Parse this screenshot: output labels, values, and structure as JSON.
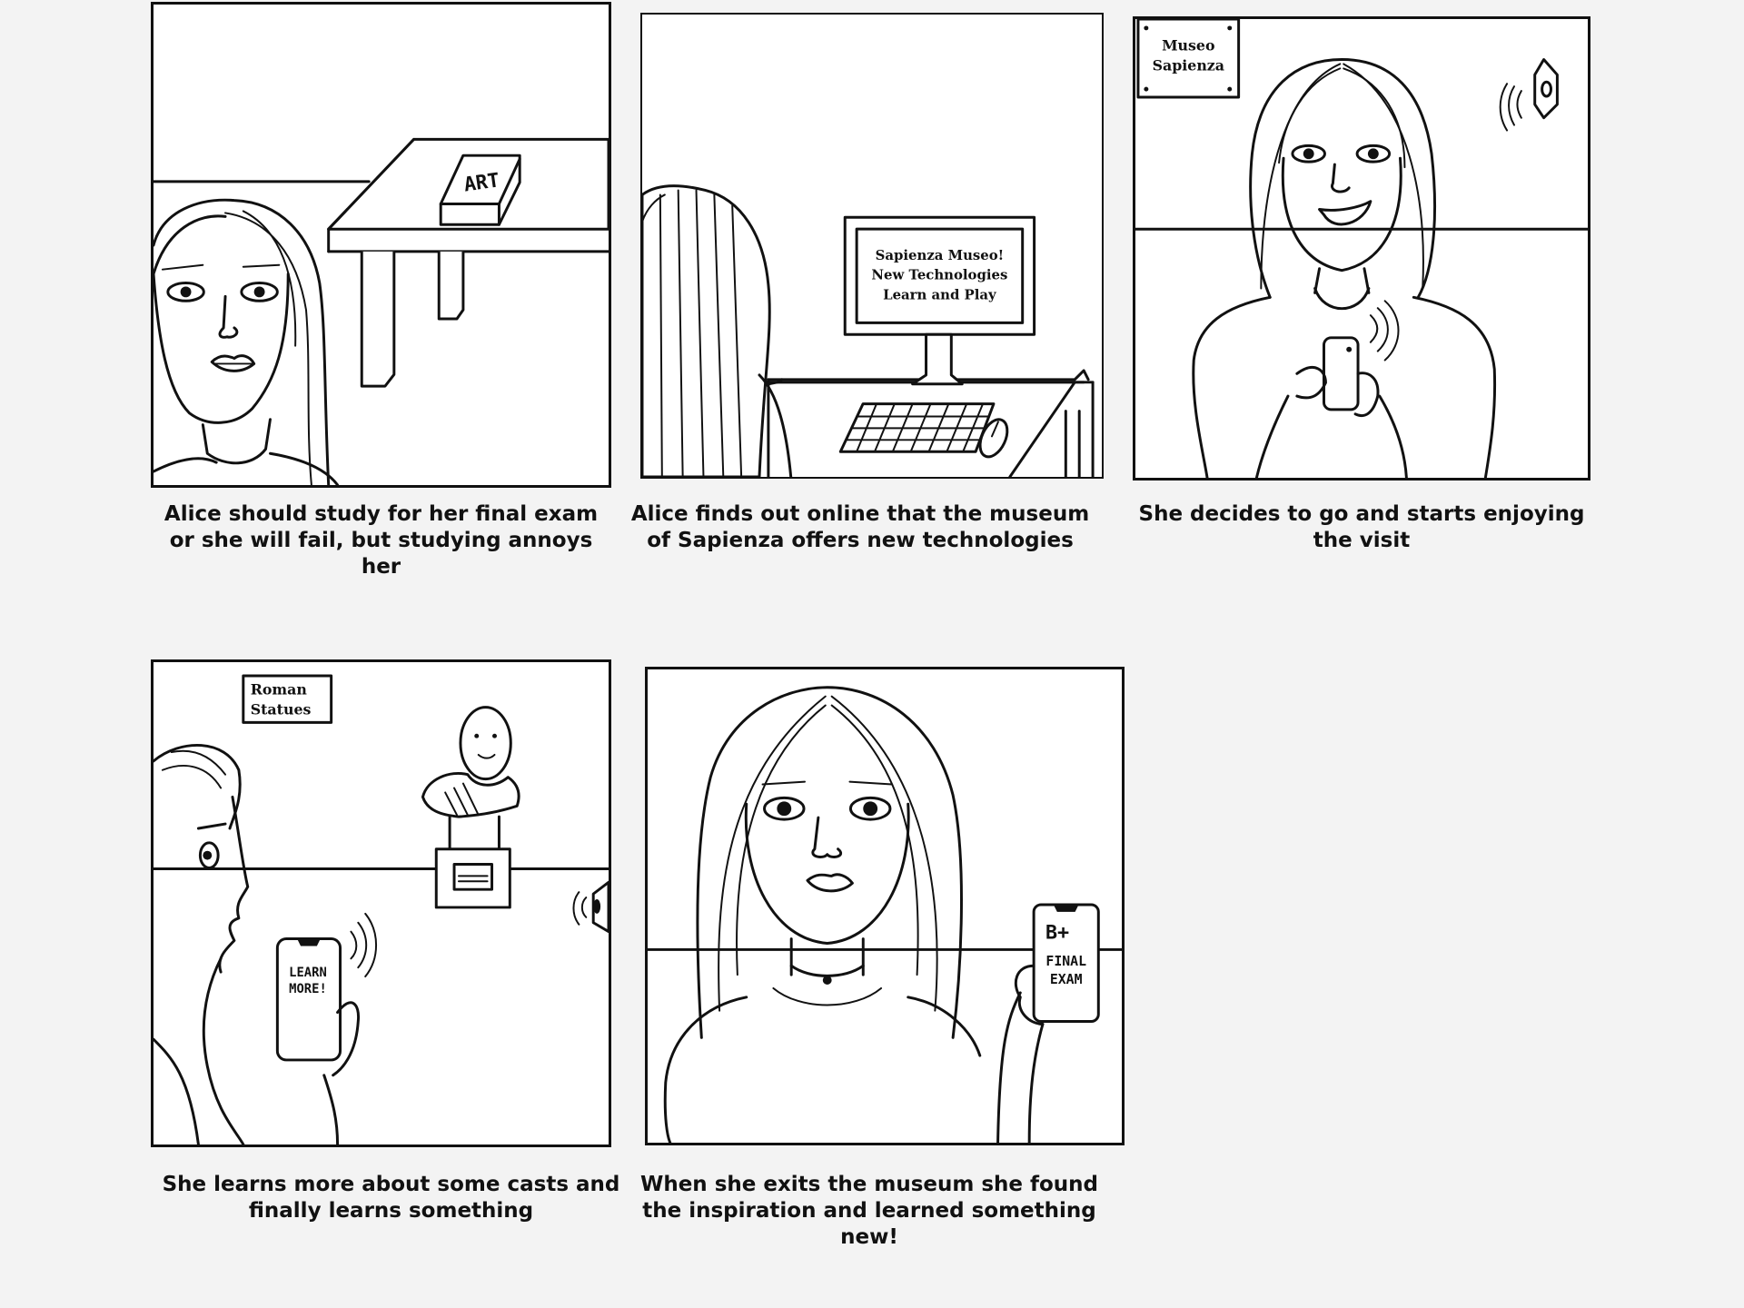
{
  "panels": [
    {
      "caption": "Alice should study for her final exam or she will fail, but studying annoys her",
      "drawn_text": {
        "book": "ART"
      }
    },
    {
      "caption": "Alice finds out online that the museum of Sapienza offers new technologies",
      "drawn_text": {
        "screen_line1": "Sapienza Museo!",
        "screen_line2": "New Technologies",
        "screen_line3": "Learn and Play"
      }
    },
    {
      "caption": "She decides to go and starts enjoying the visit",
      "drawn_text": {
        "sign_line1": "Museo",
        "sign_line2": "Sapienza"
      }
    },
    {
      "caption": "She learns more about some casts and finally learns something",
      "drawn_text": {
        "sign_line1": "Roman",
        "sign_line2": "Statues",
        "phone_line1": "LEARN",
        "phone_line2": "MORE!"
      }
    },
    {
      "caption": "When she exits the museum she found the inspiration and learned something new!",
      "drawn_text": {
        "phone_line1": "B+",
        "phone_line2": "FINAL",
        "phone_line3": "EXAM"
      }
    }
  ]
}
